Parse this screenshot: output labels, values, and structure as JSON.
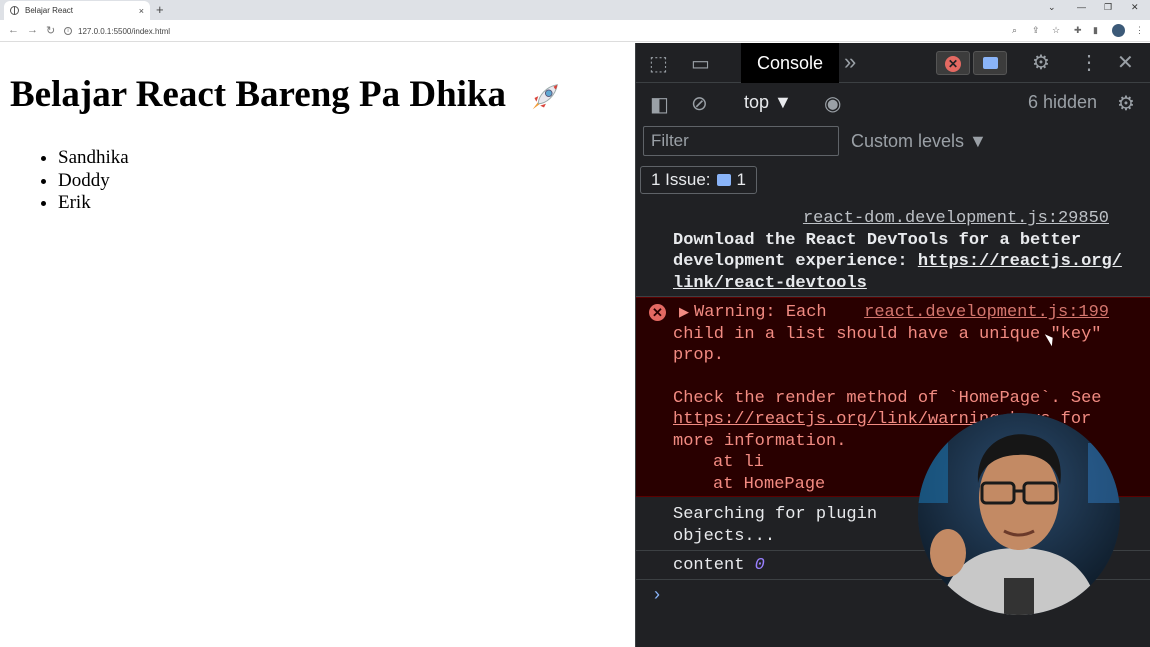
{
  "browser": {
    "tab_title": "Belajar React",
    "tab_close": "×",
    "new_tab": "+",
    "url": "127.0.0.1:5500/index.html"
  },
  "page": {
    "heading": "Belajar React Bareng Pa Dhika",
    "list_items": [
      "Sandhika",
      "Doddy",
      "Erik"
    ]
  },
  "devtools": {
    "console_tab": "Console",
    "context": "top ▼",
    "hidden_count": "6 hidden",
    "filter_placeholder": "Filter",
    "custom_levels": "Custom levels ▼",
    "issues_label": "1 Issue:",
    "issues_count": "1",
    "messages": {
      "devtools_source": "react-dom.development.js:29850",
      "devtools_text": "Download the React DevTools for a better development experience:",
      "devtools_link": "https://reactjs.org/link/react-devtools",
      "warning_title": "Warning: Each child in a list should have a unique \"key\" prop.",
      "warning_source": "react.development.js:199",
      "warning_check": "Check the render method of `HomePage`. See",
      "warning_link": "https://reactjs.org/link/warning-keys",
      "warning_more": "for more information.",
      "stack_1": "at li",
      "stack_2": "at HomePage",
      "search_text": "Searching for plugin objects...",
      "content_label": "content",
      "content_value": "0"
    },
    "prompt": "›"
  },
  "colors": {
    "devtools_bg": "#202124",
    "error_bg": "#290000",
    "error_text": "#f28b82",
    "accent": "#8ab4f8"
  }
}
